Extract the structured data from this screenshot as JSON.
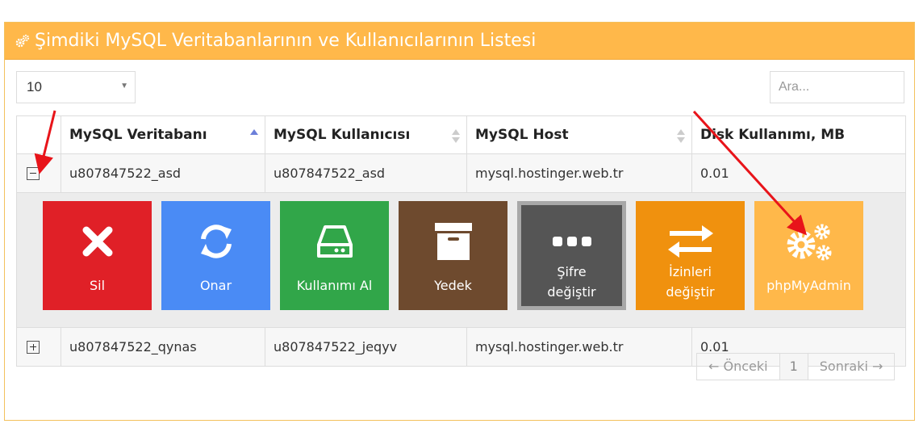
{
  "panel": {
    "title": "Şimdiki MySQL Veritabanlarının ve Kullanıcılarının Listesi",
    "header_color": "#ffb84a"
  },
  "controls": {
    "page_size": "10",
    "search_placeholder": "Ara..."
  },
  "table": {
    "columns": [
      "MySQL Veritabanı",
      "MySQL Kullanıcısı",
      "MySQL Host",
      "Disk Kullanımı, MB"
    ],
    "rows": [
      {
        "db": "u807847522_asd",
        "user": "u807847522_asd",
        "host": "mysql.hostinger.web.tr",
        "disk": "0.01",
        "expanded": true
      },
      {
        "db": "u807847522_qynas",
        "user": "u807847522_jeqyv",
        "host": "mysql.hostinger.web.tr",
        "disk": "0.01",
        "expanded": false
      }
    ]
  },
  "actions": [
    {
      "label": "Sil",
      "icon": "close-icon",
      "color": "#e02027"
    },
    {
      "label": "Onar",
      "icon": "refresh-icon",
      "color": "#4a8bf5"
    },
    {
      "label": "Kullanımı Al",
      "icon": "hard-drive-icon",
      "color": "#31a649"
    },
    {
      "label": "Yedek",
      "icon": "archive-icon",
      "color": "#6e4a2e"
    },
    {
      "label1": "Şifre",
      "label2": "değiştir",
      "icon": "dots-icon",
      "color": "#555555"
    },
    {
      "label1": "İzinleri",
      "label2": "değiştir",
      "icon": "swap-arrows-icon",
      "color": "#f0910e"
    },
    {
      "label": "phpMyAdmin",
      "icon": "gears-icon",
      "color": "#ffb84a"
    }
  ],
  "pagination": {
    "prev": "← Önceki",
    "current": "1",
    "next": "Sonraki →"
  }
}
